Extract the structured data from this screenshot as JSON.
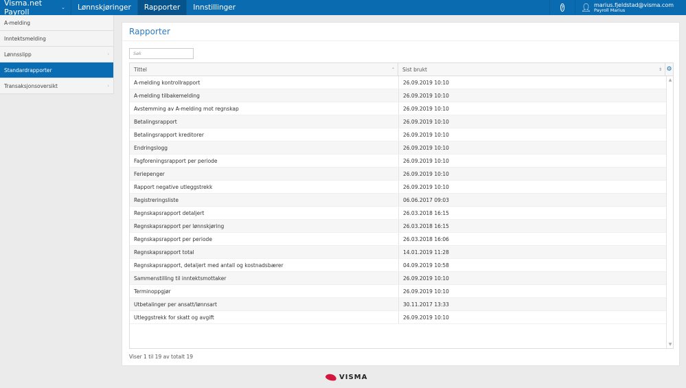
{
  "header": {
    "app_title": "Visma.net Payroll",
    "nav": [
      "Lønnskjøringer",
      "Rapporter",
      "Innstillinger"
    ],
    "active_nav": "Rapporter",
    "help_icon": "?",
    "user_email": "marius.fjeldstad@visma.com",
    "user_name": "Payroll Marius"
  },
  "sidebar": {
    "items": [
      {
        "label": "A-melding"
      },
      {
        "label": "Inntektsmelding"
      },
      {
        "label": "Lønnsslipp"
      },
      {
        "label": "Standardrapporter"
      },
      {
        "label": "Transaksjonsoversikt"
      }
    ],
    "active": "Standardrapporter"
  },
  "main": {
    "title": "Rapporter",
    "search_placeholder": "Søk",
    "columns": [
      "Tittel",
      "Sist brukt"
    ],
    "rows": [
      [
        "A-melding kontrollrapport",
        "26.09.2019 10:10"
      ],
      [
        "A-melding tilbakemelding",
        "26.09.2019 10:10"
      ],
      [
        "Avstemming av A-melding mot regnskap",
        "26.09.2019 10:10"
      ],
      [
        "Betalingsrapport",
        "26.09.2019 10:10"
      ],
      [
        "Betalingsrapport kreditorer",
        "26.09.2019 10:10"
      ],
      [
        "Endringslogg",
        "26.09.2019 10:10"
      ],
      [
        "Fagforeningsrapport per periode",
        "26.09.2019 10:10"
      ],
      [
        "Feriepenger",
        "26.09.2019 10:10"
      ],
      [
        "Rapport negative utleggstrekk",
        "26.09.2019 10:10"
      ],
      [
        "Registreringsliste",
        "06.06.2017 09:03"
      ],
      [
        "Regnskapsrapport detaljert",
        "26.03.2018 16:15"
      ],
      [
        "Regnskapsrapport per lønnskjøring",
        "26.03.2018 16:15"
      ],
      [
        "Regnskapsrapport per periode",
        "26.03.2018 16:06"
      ],
      [
        "Regnskapsrapport total",
        "14.01.2019 11:28"
      ],
      [
        "Regnskapsrapport, detaljert med antall og kostnadsbærer",
        "04.09.2019 10:58"
      ],
      [
        "Sammenstilling til inntektsmottaker",
        "26.09.2019 10:10"
      ],
      [
        "Terminoppgjør",
        "26.09.2019 10:10"
      ],
      [
        "Utbetalinger per ansatt/lønnsart",
        "30.11.2017 13:33"
      ],
      [
        "Utleggstrekk for skatt og avgift",
        "26.09.2019 10:10"
      ]
    ],
    "footer": "Viser 1 til 19 av totalt 19"
  },
  "brand_logo": "VISMA"
}
